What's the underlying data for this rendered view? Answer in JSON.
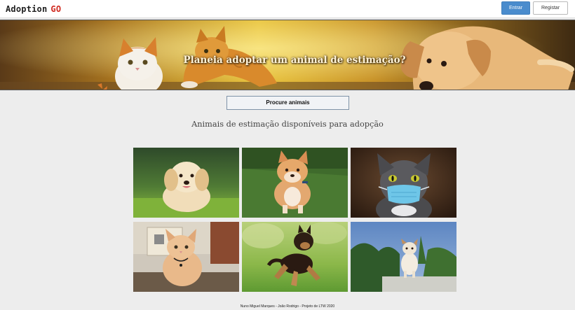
{
  "header": {
    "logo_text": "Adoption",
    "logo_accent": "GO",
    "login_label": "Entrar",
    "register_label": "Registar"
  },
  "hero": {
    "title": "Planeia adoptar um animal de estimação?"
  },
  "search": {
    "button_label": "Procure animais"
  },
  "main": {
    "section_title": "Animais de estimação disponíveis para adopção",
    "pets": [
      {
        "animal": "puppy"
      },
      {
        "animal": "shiba dog"
      },
      {
        "animal": "cat with mask"
      },
      {
        "animal": "kitten"
      },
      {
        "animal": "running puppy"
      },
      {
        "animal": "small dog"
      }
    ]
  },
  "footer": {
    "text": "Nuno Miguel Marques - João Rodrigo - Projeto de LTW 2020"
  },
  "colors": {
    "accent": "#4a8ccd",
    "logo_go": "#d02a20",
    "background": "#ededed"
  }
}
